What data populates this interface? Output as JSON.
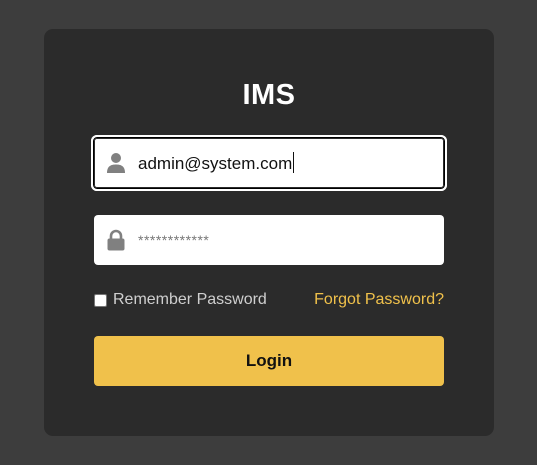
{
  "app": {
    "title": "IMS"
  },
  "form": {
    "email": {
      "value": "admin@system.com",
      "icon": "user-icon"
    },
    "password": {
      "masked_value": "************",
      "icon": "lock-icon"
    },
    "remember": {
      "label": "Remember Password",
      "checked": false
    },
    "forgot_label": "Forgot Password?",
    "login_label": "Login"
  },
  "colors": {
    "page_background": "#3d3d3d",
    "card_background": "#2b2b2b",
    "accent": "#f0c14b",
    "icon_gray": "#808080"
  }
}
